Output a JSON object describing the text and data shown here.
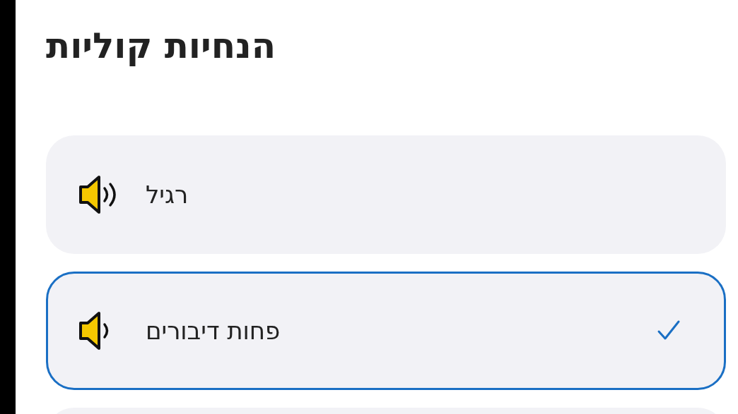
{
  "title": "הנחיות קוליות",
  "options": [
    {
      "kind": "full",
      "label": "רגיל",
      "selected": false
    },
    {
      "kind": "reduced",
      "label": "פחות דיבורים",
      "selected": true
    },
    {
      "kind": "cut_off"
    }
  ]
}
